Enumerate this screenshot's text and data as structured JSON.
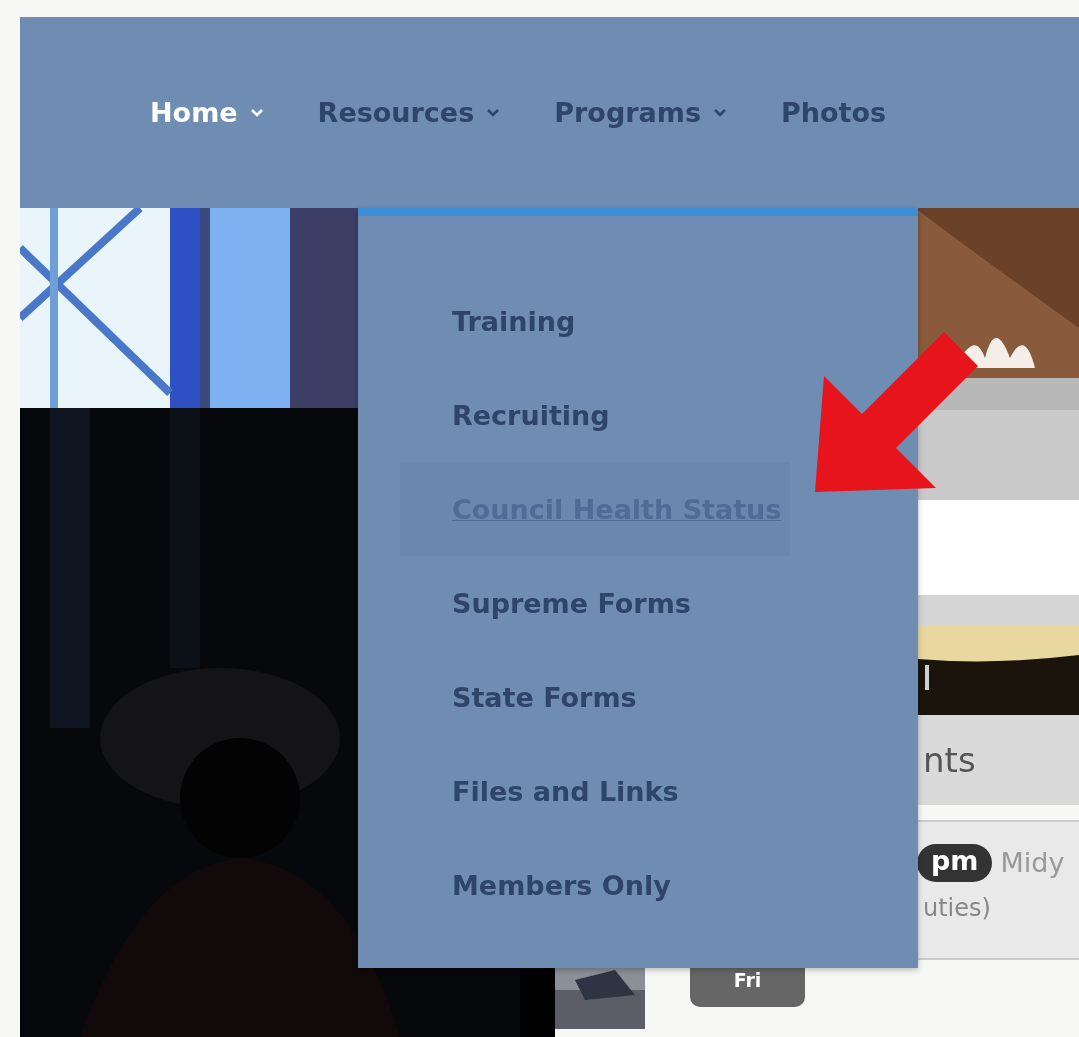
{
  "nav": {
    "items": [
      {
        "label": "Home",
        "selected": true,
        "has_menu": true
      },
      {
        "label": "Resources",
        "selected": false,
        "has_menu": true
      },
      {
        "label": "Programs",
        "selected": false,
        "has_menu": true
      },
      {
        "label": "Photos",
        "selected": false,
        "has_menu": false
      }
    ]
  },
  "dropdown": {
    "items": [
      {
        "label": "Training",
        "selected": false
      },
      {
        "label": "Recruiting",
        "selected": false
      },
      {
        "label": "Council Health Status",
        "selected": true
      },
      {
        "label": "Supreme Forms",
        "selected": false
      },
      {
        "label": "State Forms",
        "selected": false
      },
      {
        "label": "Files and Links",
        "selected": false
      },
      {
        "label": "Members Only",
        "selected": false
      }
    ]
  },
  "events": {
    "heading": "nts",
    "time": "pm",
    "title": "Midy",
    "detail": "uties)",
    "day": "Fri"
  }
}
